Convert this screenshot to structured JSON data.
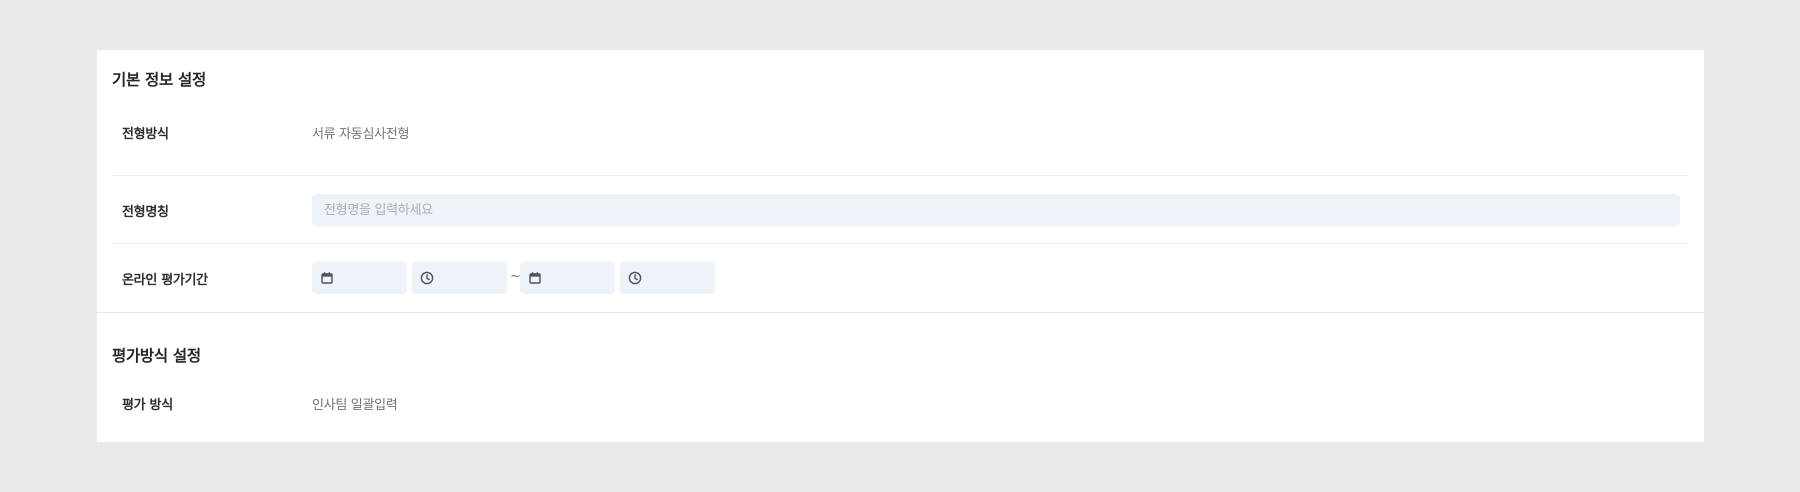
{
  "basic_section": {
    "title": "기본 정보 설정",
    "screening_method": {
      "label": "전형방식",
      "value": "서류 자동심사전형"
    },
    "screening_name": {
      "label": "전형명칭",
      "placeholder": "전형명을 입력하세요",
      "value": ""
    },
    "online_period": {
      "label": "온라인 평가기간",
      "separator": "~",
      "start_date_icon": "calendar-icon",
      "start_time_icon": "clock-icon",
      "end_date_icon": "calendar-icon",
      "end_time_icon": "clock-icon"
    }
  },
  "evaluation_section": {
    "title": "평가방식 설정",
    "evaluation_method": {
      "label": "평가 방식",
      "value": "인사팀 일괄입력"
    }
  },
  "colors": {
    "page_background": "#e8ebee",
    "card_background": "#ffffff",
    "input_background": "#eef2f9",
    "icon_color": "#4a5360"
  }
}
